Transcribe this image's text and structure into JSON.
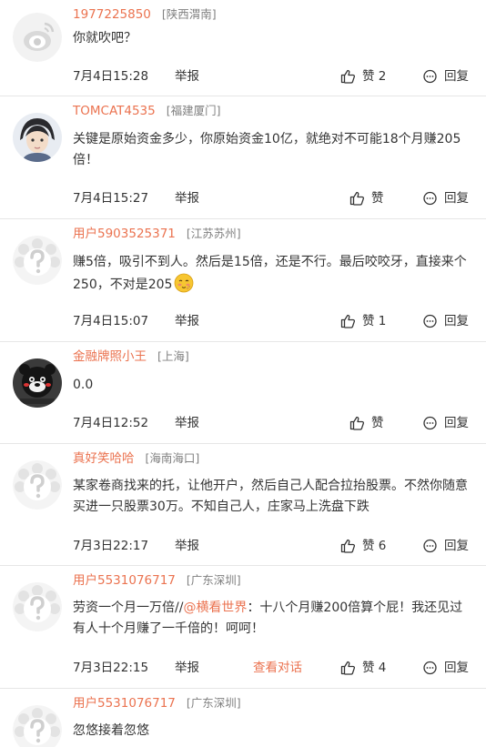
{
  "comments": [
    {
      "username": "1977225850",
      "location": "[陕西渭南]",
      "text": "你就吹吧？",
      "time": "7月4日15:28",
      "report": "举报",
      "like": "赞 2",
      "reply": "回复",
      "avatar": "default-weibo-avatar"
    },
    {
      "username": "TOMCAT4535",
      "location": "[福建厦门]",
      "text": "关键是原始资金多少，你原始资金10亿，就绝对不可能18个月赚205倍！",
      "time": "7月4日15:27",
      "report": "举报",
      "like": "赞",
      "reply": "回复",
      "avatar": "photo-avatar"
    },
    {
      "username": "用户5903525371",
      "location": "[江苏苏州]",
      "text": "赚5倍，吸引不到人。然后是15倍，还是不行。最后咬咬牙，直接来个250，不对是205",
      "emoji": "shy-face-emoji",
      "time": "7月4日15:07",
      "report": "举报",
      "like": "赞 1",
      "reply": "回复",
      "avatar": "unknown-user-avatar"
    },
    {
      "username": "金融牌照小王",
      "location": "[上海]",
      "text": "0.0",
      "time": "7月4日12:52",
      "report": "举报",
      "like": "赞",
      "reply": "回复",
      "avatar": "bear-photo-avatar"
    },
    {
      "username": "真好笑哈哈",
      "location": "[海南海口]",
      "text": "某家卷商找来的托，让他开户，然后自己人配合拉抬股票。不然你随意买进一只股票30万。不知自己人，庄家马上洗盘下跌",
      "time": "7月3日22:17",
      "report": "举报",
      "like": "赞 6",
      "reply": "回复",
      "avatar": "unknown-user-avatar"
    },
    {
      "username": "用户5531076717",
      "location": "[广东深圳]",
      "text_before": "劳资一个月一万倍//",
      "mention": "@横看世界",
      "text_after": "：十八个月赚200倍算个屁！我还见过有人十个月赚了一千倍的！呵呵！",
      "time": "7月3日22:15",
      "report": "举报",
      "dialog": "查看对话",
      "like": "赞 4",
      "reply": "回复",
      "avatar": "unknown-user-avatar"
    },
    {
      "username": "用户5531076717",
      "location": "[广东深圳]",
      "text": "忽悠接着忽悠",
      "avatar": "unknown-user-avatar"
    }
  ],
  "colors": {
    "username": "#eb7350",
    "text": "#333333",
    "location": "#808080",
    "divider": "#e6e6e6"
  }
}
